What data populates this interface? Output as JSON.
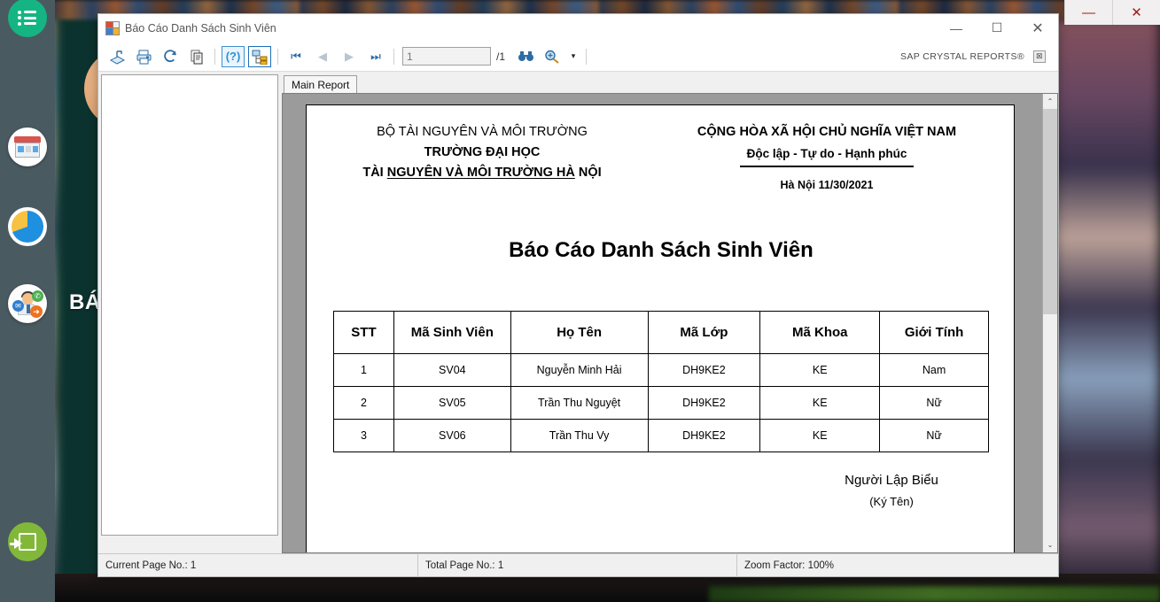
{
  "desktop": {
    "background_label": "BÁO",
    "dock_items": [
      {
        "name": "menu-list",
        "icon": "hamburger-list-icon"
      },
      {
        "name": "store",
        "icon": "shop-house-icon"
      },
      {
        "name": "statistics",
        "icon": "pie-chart-icon"
      },
      {
        "name": "support",
        "icon": "support-agent-icon"
      },
      {
        "name": "logout",
        "icon": "exit-arrow-icon"
      }
    ]
  },
  "os_controls": {
    "minimize": "—",
    "close": "✕"
  },
  "window": {
    "title": "Báo Cáo Danh Sách Sinh Viên",
    "icon": "report-form-icon",
    "minimize": "—",
    "maximize": "☐",
    "close": "✕"
  },
  "toolbar": {
    "buttons": [
      {
        "name": "export-button",
        "icon": "export-icon",
        "tooltip": "Export"
      },
      {
        "name": "print-button",
        "icon": "printer-icon",
        "tooltip": "Print"
      },
      {
        "name": "refresh-button",
        "icon": "refresh-icon",
        "tooltip": "Refresh"
      },
      {
        "name": "copy-button",
        "icon": "copy-icon",
        "tooltip": "Copy"
      },
      {
        "name": "help-button",
        "icon": "question-mark-icon",
        "tooltip": "Help"
      },
      {
        "name": "toggle-group-tree-button",
        "icon": "group-tree-icon",
        "tooltip": "Toggle Group Tree"
      }
    ],
    "nav": {
      "first": "⏮",
      "prev": "◀",
      "next": "▶",
      "last": "⏭"
    },
    "page_value": "1",
    "page_placeholder": "1",
    "page_total": "/1",
    "find_icon": "binoculars-icon",
    "zoom_icon": "zoom-magnifier-icon",
    "zoom_dropdown": "▾",
    "brand": "SAP CRYSTAL REPORTS®",
    "brand_close": "⊠"
  },
  "tabs": [
    {
      "label": "Main Report",
      "active": true
    }
  ],
  "report": {
    "header_left": {
      "line1": "BỘ TÀI NGUYÊN VÀ MÔI TRƯỜNG",
      "line2": "TRƯỜNG ĐẠI HỌC",
      "line3_prefix": "TÀI ",
      "line3_underlined": "NGUYÊN VÀ MÔI TRƯỜNG HÀ",
      "line3_suffix": " NỘI"
    },
    "header_right": {
      "line1": "CỘNG HÒA XÃ HỘI CHỦ NGHĨA VIỆT NAM",
      "line2": "Độc lập - Tự do - Hạnh phúc",
      "line3": "Hà Nội  11/30/2021"
    },
    "title": "Báo Cáo Danh Sách Sinh Viên",
    "table": {
      "columns": [
        "STT",
        "Mã Sinh Viên",
        "Họ Tên",
        "Mã Lớp",
        "Mã Khoa",
        "Giới Tính"
      ],
      "rows": [
        [
          "1",
          "SV04",
          "Nguyễn Minh Hải",
          "DH9KE2",
          "KE",
          "Nam"
        ],
        [
          "2",
          "SV05",
          "Trần Thu Nguyệt",
          "DH9KE2",
          "KE",
          "Nữ"
        ],
        [
          "3",
          "SV06",
          "Trần Thu Vy",
          "DH9KE2",
          "KE",
          "Nữ"
        ]
      ]
    },
    "footer": {
      "line1": "Người Lập Biểu",
      "line2": "(Ký Tên)"
    }
  },
  "statusbar": {
    "current_page": "Current Page No.: 1",
    "total_page": "Total Page No.: 1",
    "zoom_factor": "Zoom Factor: 100%"
  },
  "scrollbar": {
    "up": "⌃",
    "down": "⌄"
  }
}
